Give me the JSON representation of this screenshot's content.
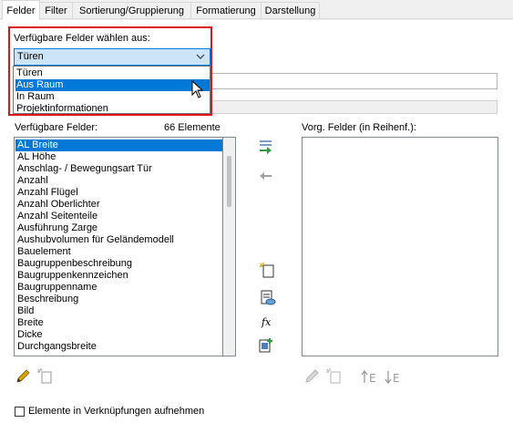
{
  "tabs": [
    "Felder",
    "Filter",
    "Sortierung/Gruppierung",
    "Formatierung",
    "Darstellung"
  ],
  "available_from_label": "Verfügbare Felder wählen aus:",
  "combo_value": "Türen",
  "dropdown_options": [
    "Türen",
    "Aus Raum",
    "In Raum",
    "Projektinformationen"
  ],
  "available_fields_label": "Verfügbare Felder:",
  "available_fields_count": "66 Elemente",
  "available_fields": [
    "AL Breite",
    "AL Höhe",
    "Anschlag- / Bewegungsart Tür",
    "Anzahl",
    "Anzahl Flügel",
    "Anzahl Oberlichter",
    "Anzahl Seitenteile",
    "Ausführung Zarge",
    "Aushubvolumen für Geländemodell",
    "Bauelement",
    "Baugruppenbeschreibung",
    "Baugruppenkennzeichen",
    "Baugruppenname",
    "Beschreibung",
    "Bild",
    "Breite",
    "Dicke",
    "Durchgangsbreite"
  ],
  "scheduled_fields_label": "Vorg. Felder (in Reihenf.):",
  "include_links_label": "Elemente in Verknüpfungen aufnehmen",
  "colors": {
    "accent": "#0078d7",
    "highlight_frame": "#e0141e",
    "combo_bg": "#cce4f7"
  },
  "icons": [
    "add-field-icon",
    "remove-field-icon",
    "new-parameter-icon",
    "edit-parameter-icon",
    "formula-icon",
    "combine-parameters-icon",
    "edit-icon",
    "delete-icon",
    "move-up-icon",
    "move-down-icon",
    "chevron-down-icon",
    "mouse-cursor-icon"
  ]
}
